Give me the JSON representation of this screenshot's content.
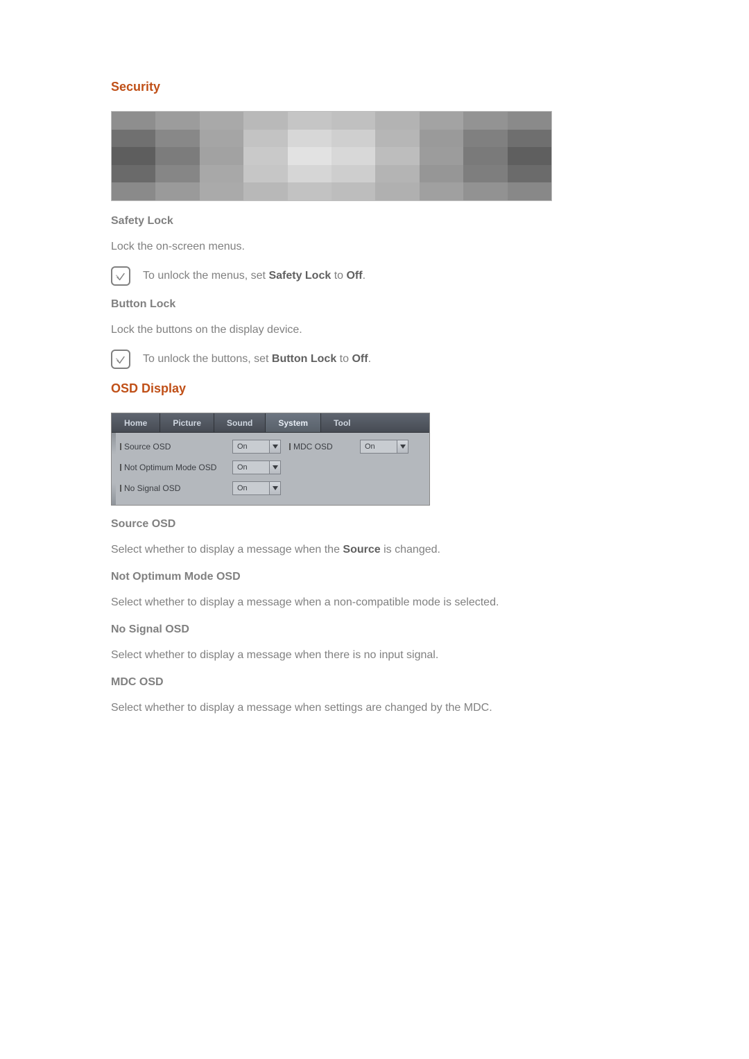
{
  "security": {
    "heading": "Security",
    "safety_lock": {
      "title": "Safety Lock",
      "desc": "Lock the on-screen menus.",
      "note_pre": "To unlock the menus, set ",
      "note_bold1": "Safety Lock",
      "note_mid": " to ",
      "note_bold2": "Off",
      "note_post": "."
    },
    "button_lock": {
      "title": "Button Lock",
      "desc": "Lock the buttons on the display device.",
      "note_pre": "To unlock the buttons, set ",
      "note_bold1": "Button Lock",
      "note_mid": " to ",
      "note_bold2": "Off",
      "note_post": "."
    }
  },
  "osd": {
    "heading": "OSD Display",
    "tabs": [
      "Home",
      "Picture",
      "Sound",
      "System",
      "Tool"
    ],
    "active_tab": "System",
    "rows": [
      {
        "label": "Source OSD",
        "value": "On",
        "label2": "MDC OSD",
        "value2": "On"
      },
      {
        "label": "Not Optimum Mode OSD",
        "value": "On"
      },
      {
        "label": "No Signal OSD",
        "value": "On"
      }
    ],
    "source": {
      "title": "Source OSD",
      "pre": "Select whether to display a message when the ",
      "bold": "Source",
      "post": " is changed."
    },
    "not_optimum": {
      "title": "Not Optimum Mode OSD",
      "desc": "Select whether to display a message when a non-compatible mode is selected."
    },
    "no_signal": {
      "title": "No Signal OSD",
      "desc": "Select whether to display a message when there is no input signal."
    },
    "mdc": {
      "title": "MDC OSD",
      "desc": "Select whether to display a message when settings are changed by the MDC."
    }
  },
  "pixel_colors": [
    [
      "#8e8e8e",
      "#9c9c9c",
      "#a9a9a9",
      "#b9b9b9",
      "#c5c5c5",
      "#c0c0c0",
      "#b3b3b3",
      "#a3a3a3",
      "#939393",
      "#8a8a8a"
    ],
    [
      "#707070",
      "#888888",
      "#a5a5a5",
      "#c3c3c3",
      "#d7d7d7",
      "#cfcfcf",
      "#b6b6b6",
      "#9a9a9a",
      "#808080",
      "#6f6f6f"
    ],
    [
      "#5e5e5e",
      "#7c7c7c",
      "#a2a2a2",
      "#c9c9c9",
      "#e2e2e2",
      "#d8d8d8",
      "#bdbdbd",
      "#9c9c9c",
      "#7a7a7a",
      "#5f5f5f"
    ],
    [
      "#6a6a6a",
      "#868686",
      "#a8a8a8",
      "#c6c6c6",
      "#d6d6d6",
      "#cecece",
      "#b4b4b4",
      "#969696",
      "#7e7e7e",
      "#6b6b6b"
    ],
    [
      "#8a8a8a",
      "#9a9a9a",
      "#aaaaaa",
      "#b8b8b8",
      "#c2c2c2",
      "#bdbdbd",
      "#b0b0b0",
      "#a0a0a0",
      "#929292",
      "#888888"
    ]
  ]
}
